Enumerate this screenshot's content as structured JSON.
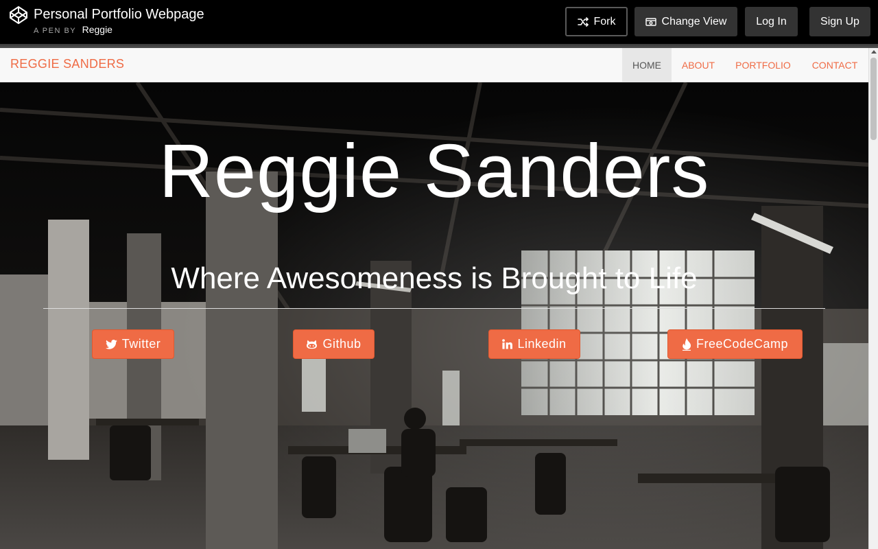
{
  "codepen": {
    "pen_title": "Personal Portfolio Webpage",
    "pen_by_label": "A PEN BY",
    "author": "Reggie",
    "buttons": {
      "fork": "Fork",
      "change_view": "Change View",
      "log_in": "Log In",
      "sign_up": "Sign Up"
    }
  },
  "site": {
    "brand": "REGGIE SANDERS",
    "nav": {
      "home": "HOME",
      "about": "ABOUT",
      "portfolio": "PORTFOLIO",
      "contact": "CONTACT",
      "active": "HOME"
    },
    "hero": {
      "title": "Reggie Sanders",
      "subtitle": "Where Awesomeness is Brought to Life"
    },
    "social": {
      "twitter": "Twitter",
      "github": "Github",
      "linkedin": "Linkedin",
      "freecodecamp": "FreeCodeCamp"
    }
  },
  "icons": {
    "logo": "codepen-logo-icon",
    "fork": "fork-icon",
    "change_view": "change-view-icon",
    "twitter": "twitter-icon",
    "github": "github-icon",
    "linkedin": "linkedin-icon",
    "freecodecamp": "fire-icon"
  },
  "colors": {
    "accent": "#ef6b45",
    "topbar": "#000000",
    "topbar_button": "#333333",
    "navbar": "#f8f8f8",
    "nav_active": "#e7e7e7"
  }
}
